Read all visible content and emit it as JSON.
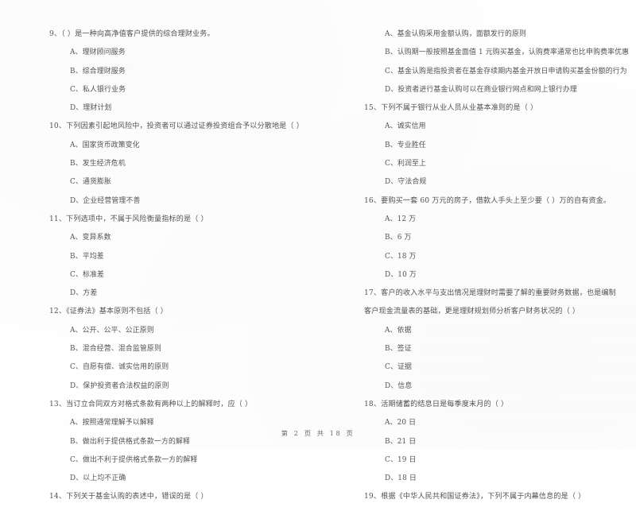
{
  "document": {
    "type": "exam-paper-scan",
    "footer": "第 2 页 共 18 页"
  },
  "columns": [
    {
      "id": "left",
      "questions": [
        {
          "number": "9",
          "stem": "9、（          ）是一种向高净值客户提供的综合理财业务。",
          "options": [
            "A、理财顾问服务",
            "B、综合理财服务",
            "C、私人银行业务",
            "D、理财计划"
          ]
        },
        {
          "number": "10",
          "stem": "10、下列因素引起地风险中，投资者可以通过证券投资组合予以分散地是（        ）",
          "options": [
            "A、国家货币政策变化",
            "B、发生经济危机",
            "C、通货膨胀",
            "D、企业经营管理不善"
          ]
        },
        {
          "number": "11",
          "stem": "11、下列选项中，不属于风险衡量指标的是（        ）",
          "options": [
            "A、变异系数",
            "B、平均差",
            "C、标准差",
            "D、方差"
          ]
        },
        {
          "number": "12",
          "stem": "12、《证券法》基本原则不包括（        ）",
          "options": [
            "A、公开、公平、公正原则",
            "B、混合经营、混合监管原则",
            "C、自愿有偿、诚实信用的原则",
            "D、保护投资者合法权益的原则"
          ]
        },
        {
          "number": "13",
          "stem": "13、当订立合同双方对格式条款有两种以上的解释时，应（        ）",
          "options": [
            "A、按照通常理解予以解释",
            "B、做出利于提供格式条款一方的解释",
            "C、做出不利于提供格式条款一方的解释",
            "D、以上均不正确"
          ]
        },
        {
          "number": "14",
          "stem": "14、下列关于基金认购的表述中，错误的是（        ）",
          "options": []
        }
      ]
    },
    {
      "id": "right",
      "questions": [
        {
          "number": "14-continued",
          "stem": "",
          "options": [
            "A、基金认购采用金额认购，面额发行的原则",
            "B、认购期一般按照基金面值 1 元购买基金，认购费率通常也比申购费率优惠",
            "C、基金认购是指投资者在基金存续期内基金开放日申请购买基金份额的行为",
            "D、投资者进行基金认购可以在商业银行网点和网上银行办理"
          ]
        },
        {
          "number": "15",
          "stem": "15、下列不属于银行从业人员从业基本准则的是（        ）",
          "options": [
            "A、诚实信用",
            "B、专业胜任",
            "C、利润至上",
            "D、守法合规"
          ]
        },
        {
          "number": "16",
          "stem": "16、要购买一套 60 万元的房子，借款人手头上至少要（        ）万的自有资金。",
          "options": [
            "A、12 万",
            "B、6 万",
            "C、18 万",
            "D、10 万"
          ]
        },
        {
          "number": "17",
          "stem": "17、客户的收入水平与支出情况是理财时需要了解的重要财务数据，也是编制客户现金流量表的基础，更是理财规划师分析客户财务状况的（        ）",
          "stem_wraps": true,
          "options": [
            "A、依据",
            "B、签证",
            "C、证据",
            "D、信息"
          ]
        },
        {
          "number": "18",
          "stem": "18、活期储蓄的结息日是每季度末月的（        ）",
          "options": [
            "A、20 日",
            "B、21 日",
            "C、19 日",
            "D、18 日"
          ]
        },
        {
          "number": "19",
          "stem": "19、根据《中华人民共和国证券法》，下列不属于内幕信息的是（        ）",
          "options": []
        }
      ]
    }
  ]
}
